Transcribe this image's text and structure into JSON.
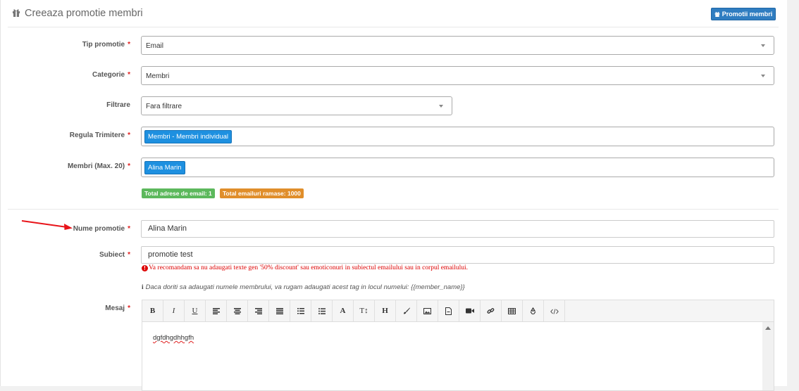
{
  "header": {
    "title": "Creeaza promotie membri",
    "promo_button": "Promotii membri"
  },
  "form": {
    "tip_promotie": {
      "label": "Tip promotie",
      "value": "Email"
    },
    "categorie": {
      "label": "Categorie",
      "value": "Membri"
    },
    "filtrare": {
      "label": "Filtrare",
      "value": "Fara filtrare"
    },
    "regula": {
      "label": "Regula Trimitere",
      "tag": "Membri - Membri individual"
    },
    "membri": {
      "label": "Membri (Max. 20)",
      "tag": "Alina Marin"
    },
    "badges": {
      "total_adrese": "Total adrese de email: 1",
      "total_emailuri": "Total emailuri ramase: 1000"
    },
    "nume": {
      "label": "Nume promotie",
      "value": "Alina Marin"
    },
    "subiect": {
      "label": "Subiect",
      "value": "promotie test"
    },
    "warning": "Va recomandam sa nu adaugati texte gen '50% discount' sau emoticonuri in subiectul emailului sau in corpul emailului.",
    "info": "Daca doriti sa adaugati numele membrului, va rugam adaugati acest tag in locul numelui: {{member_name}}",
    "mesaj": {
      "label": "Mesaj",
      "content": "dgfdhgdhhgfh"
    },
    "required_mark": "*"
  },
  "toolbar": {
    "bold": "B",
    "italic": "I",
    "underline": "U",
    "font": "A",
    "textsize": "T↕",
    "heading": "H"
  },
  "colors": {
    "primary": "#2f7dc1",
    "chip": "#1e90e0",
    "badge_green": "#5cb85c",
    "badge_orange": "#e08e2b",
    "error": "#dd0000"
  }
}
